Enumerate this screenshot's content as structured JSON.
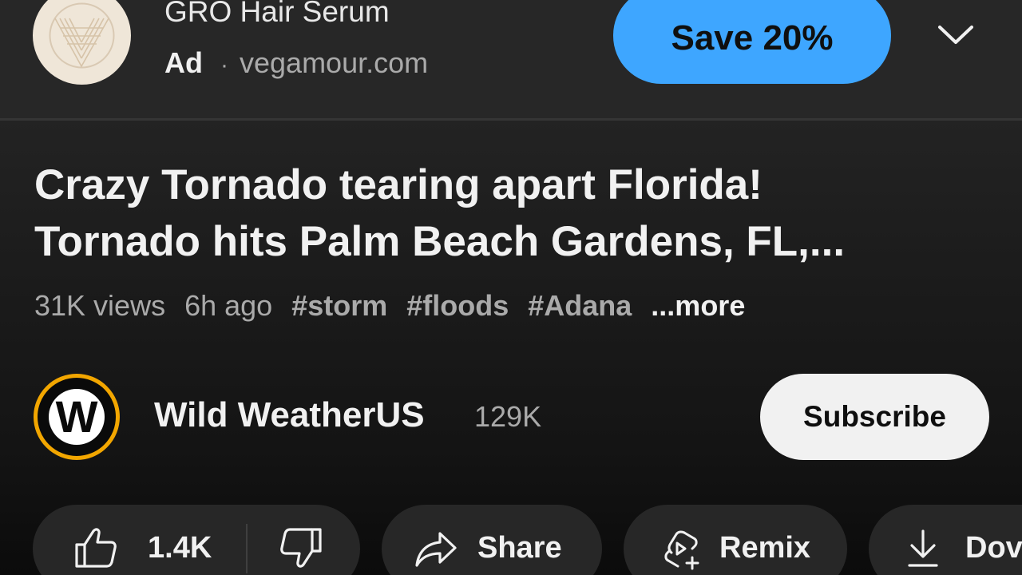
{
  "ad": {
    "title": "GRO Hair Serum",
    "badge": "Ad",
    "separator": "·",
    "domain": "vegamour.com",
    "cta_label": "Save 20%",
    "cta_color": "#3ea6ff",
    "logo_icon": "vegamour-logo",
    "menu_icon": "chevron-down-icon"
  },
  "video": {
    "title_line1": "Crazy Tornado tearing apart Florida!",
    "title_line2": "Tornado hits Palm Beach Gardens, FL,...",
    "views": "31K views",
    "age": "6h ago",
    "hashtags": [
      "#storm",
      "#floods",
      "#Adana"
    ],
    "more_label": "...more"
  },
  "channel": {
    "avatar_letter": "W",
    "avatar_ring_color": "#f2a600",
    "name": "Wild WeatherUS",
    "subscribers": "129K",
    "subscribe_label": "Subscribe"
  },
  "actions": {
    "like_count": "1.4K",
    "like_icon": "thumbs-up-icon",
    "dislike_icon": "thumbs-down-icon",
    "share_label": "Share",
    "share_icon": "share-arrow-icon",
    "remix_label": "Remix",
    "remix_icon": "remix-icon",
    "download_label": "Dov",
    "download_icon": "download-icon"
  }
}
